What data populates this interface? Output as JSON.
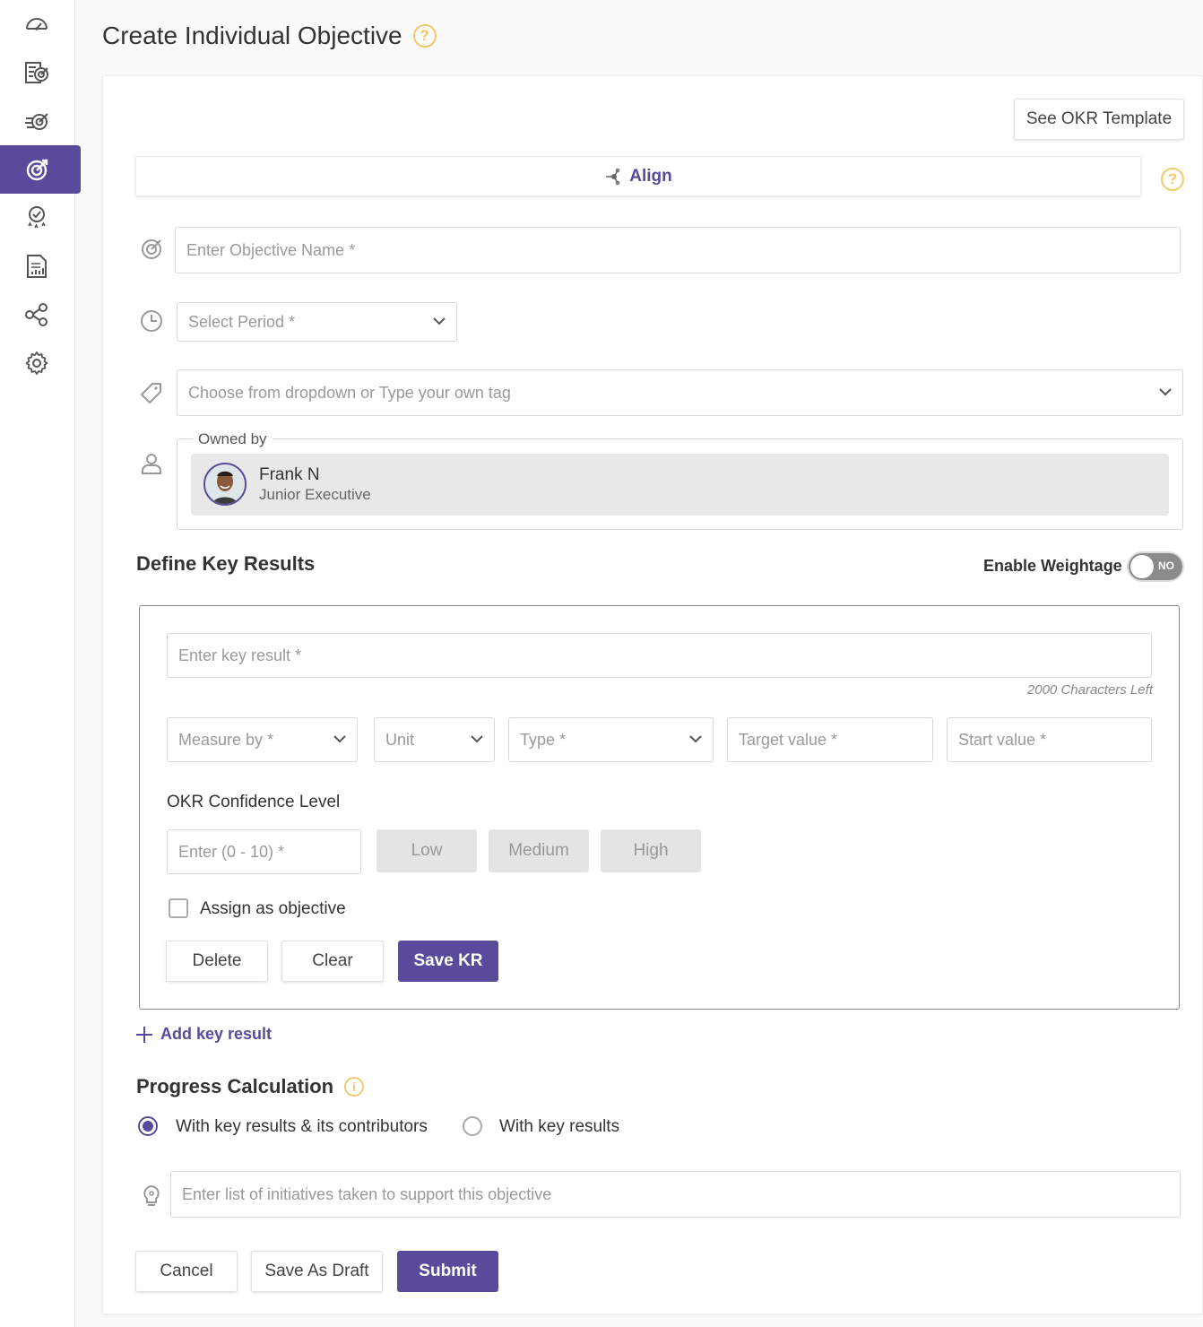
{
  "page": {
    "title": "Create Individual Objective"
  },
  "sidebar": {
    "items": [
      {
        "name": "dashboard-icon"
      },
      {
        "name": "my-goals-icon"
      },
      {
        "name": "team-goals-icon"
      },
      {
        "name": "objectives-icon"
      },
      {
        "name": "feedback-icon"
      },
      {
        "name": "reports-icon"
      },
      {
        "name": "alignment-map-icon"
      },
      {
        "name": "settings-icon"
      }
    ],
    "active_index": 3
  },
  "header": {
    "template_button": "See OKR Template"
  },
  "align": {
    "label": "Align"
  },
  "form": {
    "objective_placeholder": "Enter Objective Name *",
    "period_placeholder": "Select Period *",
    "tag_placeholder": "Choose from dropdown or Type your own tag",
    "owned_by_label": "Owned by",
    "owner": {
      "name": "Frank N",
      "role": "Junior Executive"
    }
  },
  "key_results": {
    "title": "Define Key Results",
    "weightage_label": "Enable Weightage",
    "weightage_value": "NO",
    "kr_placeholder": "Enter key result *",
    "chars_left": "2000 Characters Left",
    "measure_by": "Measure by *",
    "unit": "Unit",
    "type": "Type *",
    "target_value": "Target value *",
    "start_value": "Start value *",
    "confidence_title": "OKR Confidence Level",
    "confidence_placeholder": "Enter (0 - 10) *",
    "confidence_levels": {
      "low": "Low",
      "medium": "Medium",
      "high": "High"
    },
    "assign_label": "Assign as objective",
    "delete": "Delete",
    "clear": "Clear",
    "save": "Save KR",
    "add_kr": "Add key result"
  },
  "progress": {
    "title": "Progress Calculation",
    "option_1": "With key results & its contributors",
    "option_2": "With key results",
    "selected": 1
  },
  "initiatives": {
    "placeholder": "Enter list of initiatives taken to support this objective"
  },
  "footer": {
    "cancel": "Cancel",
    "draft": "Save As Draft",
    "submit": "Submit"
  },
  "colors": {
    "primary": "#5a4a9c",
    "help": "#f3c96b",
    "chip_bg": "#e8e8e8"
  }
}
